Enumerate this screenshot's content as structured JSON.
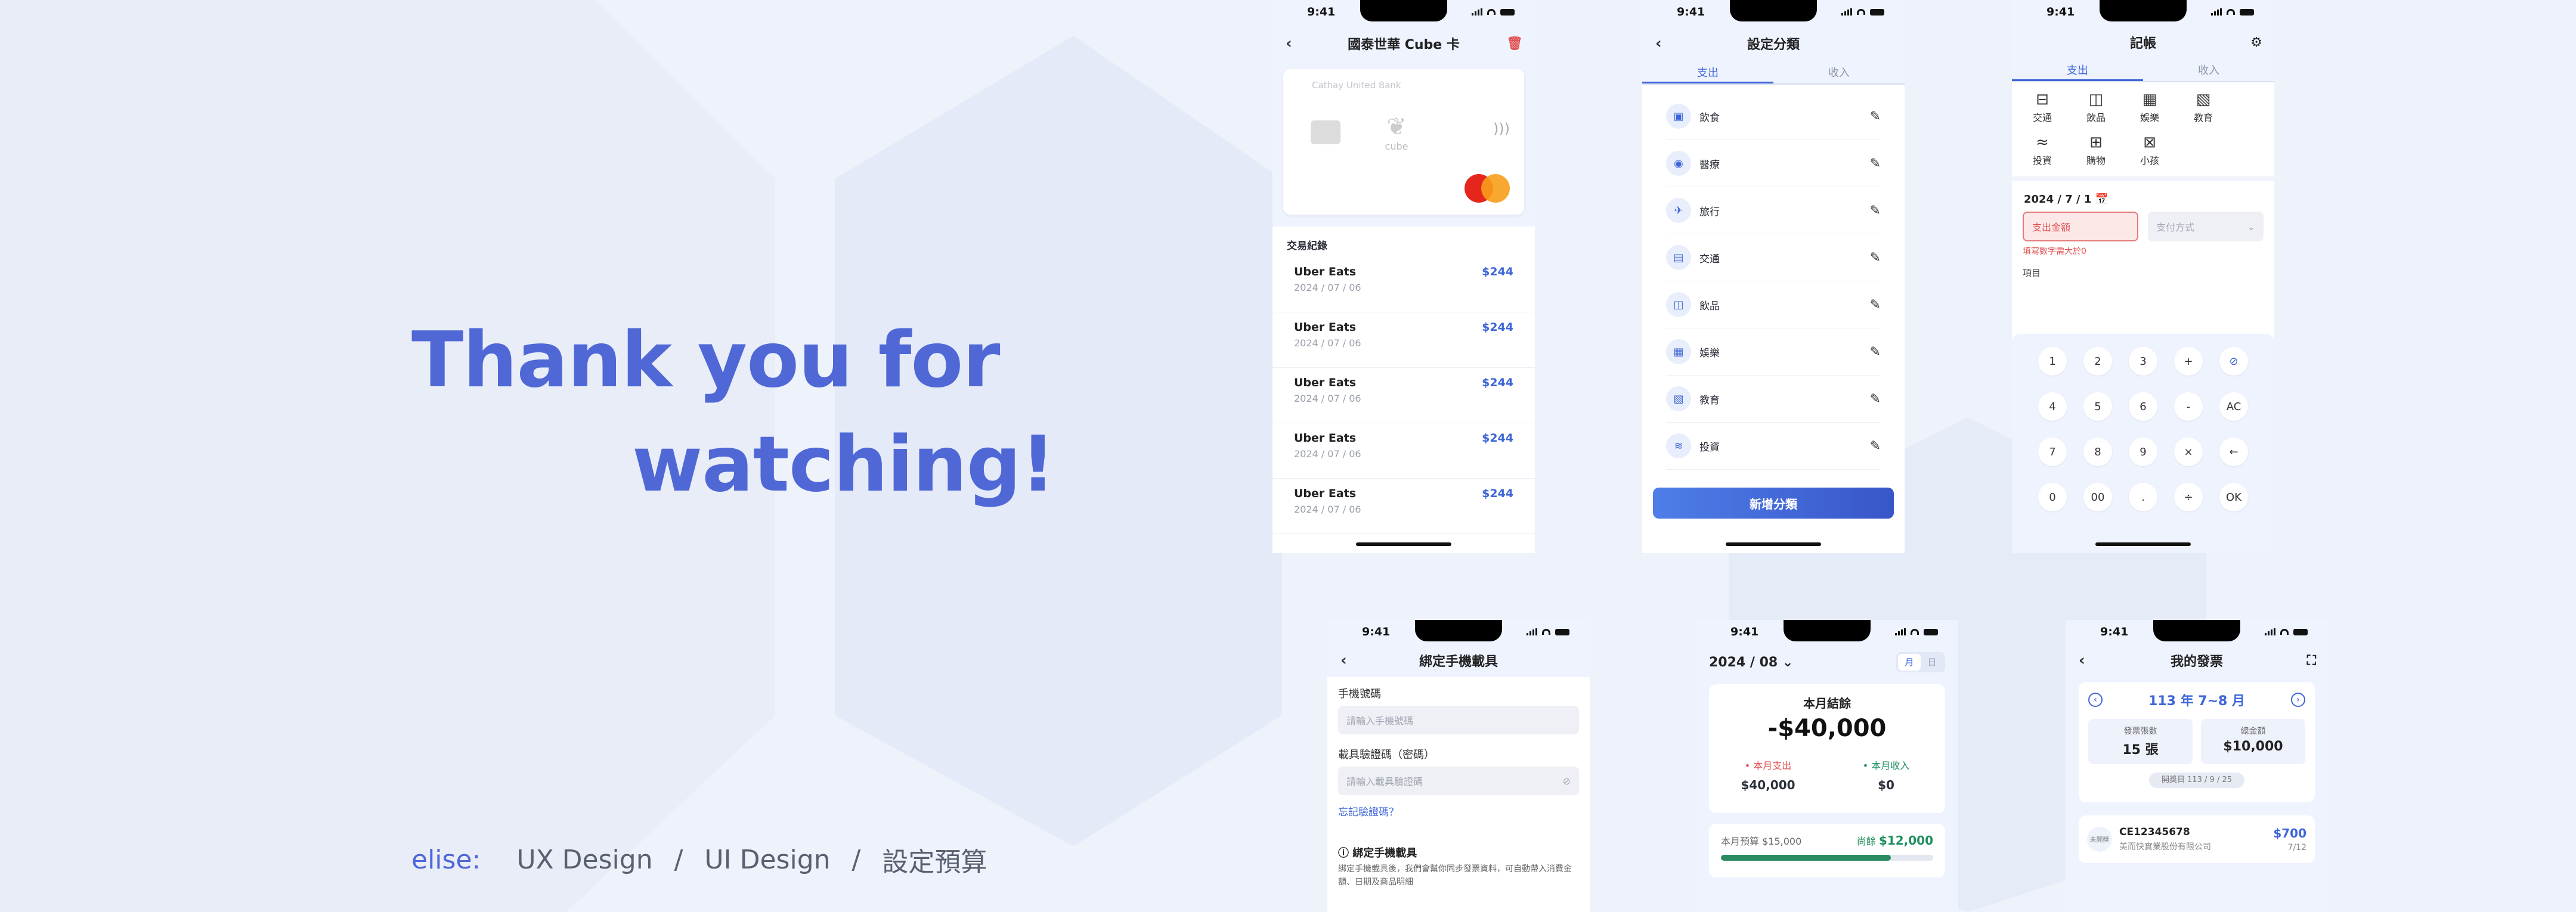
{
  "hero": {
    "line1": "Thank you for",
    "line2": "watching!"
  },
  "footer": {
    "author": "elise:",
    "items": [
      "UX Design",
      "UI Design",
      "設定預算"
    ],
    "sep": "/"
  },
  "status_time": "9:41",
  "phone1": {
    "title": "國泰世華 Cube 卡",
    "card": {
      "bank": "Cathay United Bank",
      "logo": "cube"
    },
    "tx_header": "交易紀錄",
    "transactions": [
      {
        "name": "Uber Eats",
        "date": "2024 / 07 / 06",
        "amount": "$244"
      },
      {
        "name": "Uber Eats",
        "date": "2024 / 07 / 06",
        "amount": "$244"
      },
      {
        "name": "Uber Eats",
        "date": "2024 / 07 / 06",
        "amount": "$244"
      },
      {
        "name": "Uber Eats",
        "date": "2024 / 07 / 06",
        "amount": "$244"
      },
      {
        "name": "Uber Eats",
        "date": "2024 / 07 / 06",
        "amount": "$244"
      }
    ]
  },
  "phone2": {
    "title": "設定分類",
    "tabs": [
      "支出",
      "收入"
    ],
    "categories": [
      {
        "icon": "wallet-icon",
        "glyph": "▣",
        "label": "飲食"
      },
      {
        "icon": "medical-icon",
        "glyph": "◉",
        "label": "醫療"
      },
      {
        "icon": "travel-icon",
        "glyph": "✈",
        "label": "旅行"
      },
      {
        "icon": "transport-icon",
        "glyph": "▤",
        "label": "交通"
      },
      {
        "icon": "drink-icon",
        "glyph": "◫",
        "label": "飲品"
      },
      {
        "icon": "entertainment-icon",
        "glyph": "▦",
        "label": "娛樂"
      },
      {
        "icon": "education-icon",
        "glyph": "▧",
        "label": "教育"
      },
      {
        "icon": "invest-icon",
        "glyph": "≋",
        "label": "投資"
      }
    ],
    "add_button": "新增分類"
  },
  "phone3": {
    "title": "記帳",
    "tabs": [
      "支出",
      "收入"
    ],
    "icons": [
      {
        "icon": "bus-icon",
        "glyph": "⊟",
        "label": "交通"
      },
      {
        "icon": "cup-icon",
        "glyph": "◫",
        "label": "飲品"
      },
      {
        "icon": "game-icon",
        "glyph": "▦",
        "label": "娛樂"
      },
      {
        "icon": "book-icon",
        "glyph": "▧",
        "label": "教育"
      },
      {
        "icon": "handshake-icon",
        "glyph": "≈",
        "label": "投資"
      },
      {
        "icon": "bag-icon",
        "glyph": "⊞",
        "label": "購物"
      },
      {
        "icon": "cart-icon",
        "glyph": "⊠",
        "label": "小孩"
      }
    ],
    "date": "2024 / 7 / 1",
    "amount_placeholder": "支出金額",
    "pay_placeholder": "支付方式",
    "error": "填寫數字需大於0",
    "item_label": "項目",
    "keys": [
      "1",
      "2",
      "3",
      "+",
      "⊘",
      "4",
      "5",
      "6",
      "-",
      "AC",
      "7",
      "8",
      "9",
      "×",
      "←",
      "0",
      "00",
      ".",
      "÷",
      "OK"
    ]
  },
  "phone4": {
    "title": "綁定手機載具",
    "phone_label": "手機號碼",
    "phone_placeholder": "請輸入手機號碼",
    "code_label": "載具驗證碼（密碼）",
    "code_placeholder": "請輸入載具驗證碼",
    "forgot": "忘記驗證碼？",
    "note_title": "綁定手機載具",
    "note_body": "綁定手機載具後，我們會幫你同步發票資料，可自動帶入消費金額、日期及商品明細"
  },
  "phone5": {
    "month": "2024 / 08",
    "seg": [
      "月",
      "日"
    ],
    "summary_title": "本月結餘",
    "balance": "-$40,000",
    "expense_label": "本月支出",
    "expense": "$40,000",
    "income_label": "本月收入",
    "income": "$0",
    "budget_label": "本月預算 $15,000",
    "remaining_label": "尚餘",
    "remaining": "$12,000",
    "budget_progress": 0.8
  },
  "phone6": {
    "title": "我的發票",
    "period": "113 年 7~8 月",
    "count_label": "發票張數",
    "count": "15 張",
    "total_label": "總金額",
    "total": "$10,000",
    "pill": "開獎日 113 / 9 / 25",
    "invoice": {
      "tag": "未開獎",
      "no": "CE12345678",
      "company": "美而快實業股份有限公司",
      "amount": "$700",
      "date": "7/12"
    }
  },
  "colors": {
    "accent": "#5068d6",
    "bg": "#eef2fb",
    "red": "#e05252",
    "green": "#1f8f5f"
  }
}
